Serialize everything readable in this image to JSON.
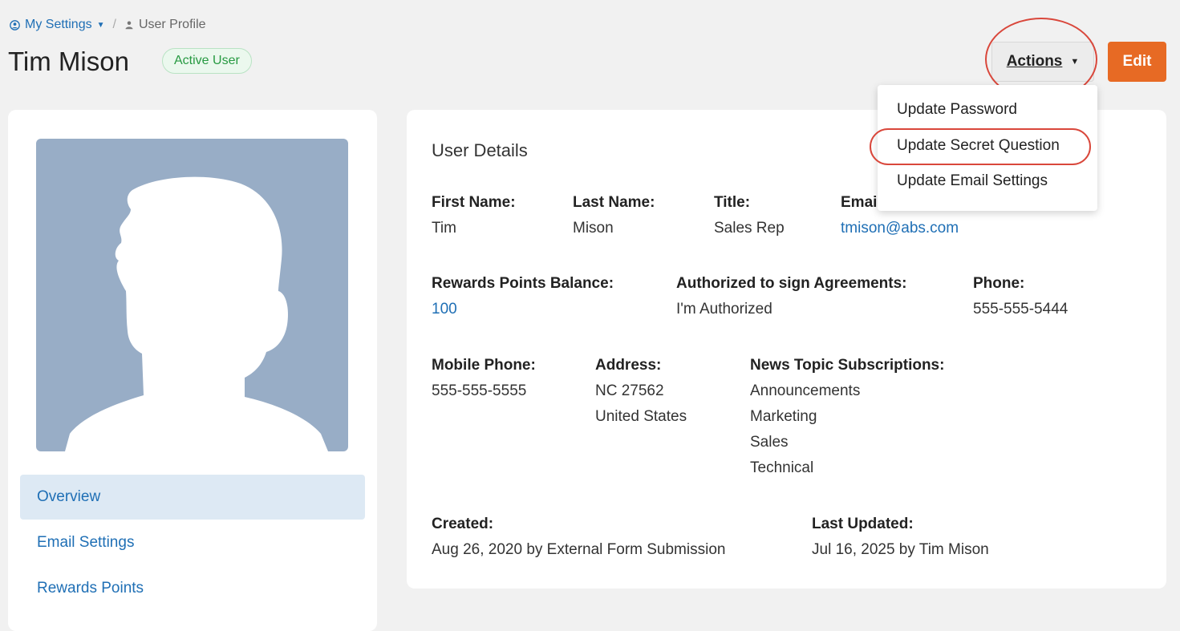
{
  "breadcrumb": {
    "parent": "My Settings",
    "current": "User Profile"
  },
  "header": {
    "title": "Tim Mison",
    "status": "Active User",
    "actions_label": "Actions",
    "edit_label": "Edit"
  },
  "actions_menu": {
    "items": [
      "Update Password",
      "Update Secret Question",
      "Update Email Settings"
    ]
  },
  "sidebar": {
    "items": [
      "Overview",
      "Email Settings",
      "Rewards Points"
    ],
    "active": "Overview"
  },
  "details": {
    "title": "User Details",
    "first_name": {
      "label": "First Name:",
      "value": "Tim"
    },
    "last_name": {
      "label": "Last Name:",
      "value": "Mison"
    },
    "job_title": {
      "label": "Title:",
      "value": "Sales Rep"
    },
    "email": {
      "label": "Email:",
      "value": "tmison@abs.com"
    },
    "rewards": {
      "label": "Rewards Points Balance:",
      "value": "100"
    },
    "authorized": {
      "label": "Authorized to sign Agreements:",
      "value": "I'm Authorized"
    },
    "phone": {
      "label": "Phone:",
      "value": "555-555-5444"
    },
    "mobile": {
      "label": "Mobile Phone:",
      "value": "555-555-5555"
    },
    "address": {
      "label": "Address:",
      "lines": [
        "NC 27562",
        "United States"
      ]
    },
    "news": {
      "label": "News Topic Subscriptions:",
      "topics": [
        "Announcements",
        "Marketing",
        "Sales",
        "Technical"
      ]
    },
    "created": {
      "label": "Created:",
      "value": "Aug 26, 2020 by External Form Submission"
    },
    "updated": {
      "label": "Last Updated:",
      "value": "Jul 16, 2025 by Tim Mison"
    }
  },
  "colors": {
    "accent_link": "#1f6fb5",
    "edit_button": "#e76a24",
    "badge_green": "#279a42",
    "highlight_red": "#d9473b",
    "avatar_bg": "#98adc6"
  }
}
